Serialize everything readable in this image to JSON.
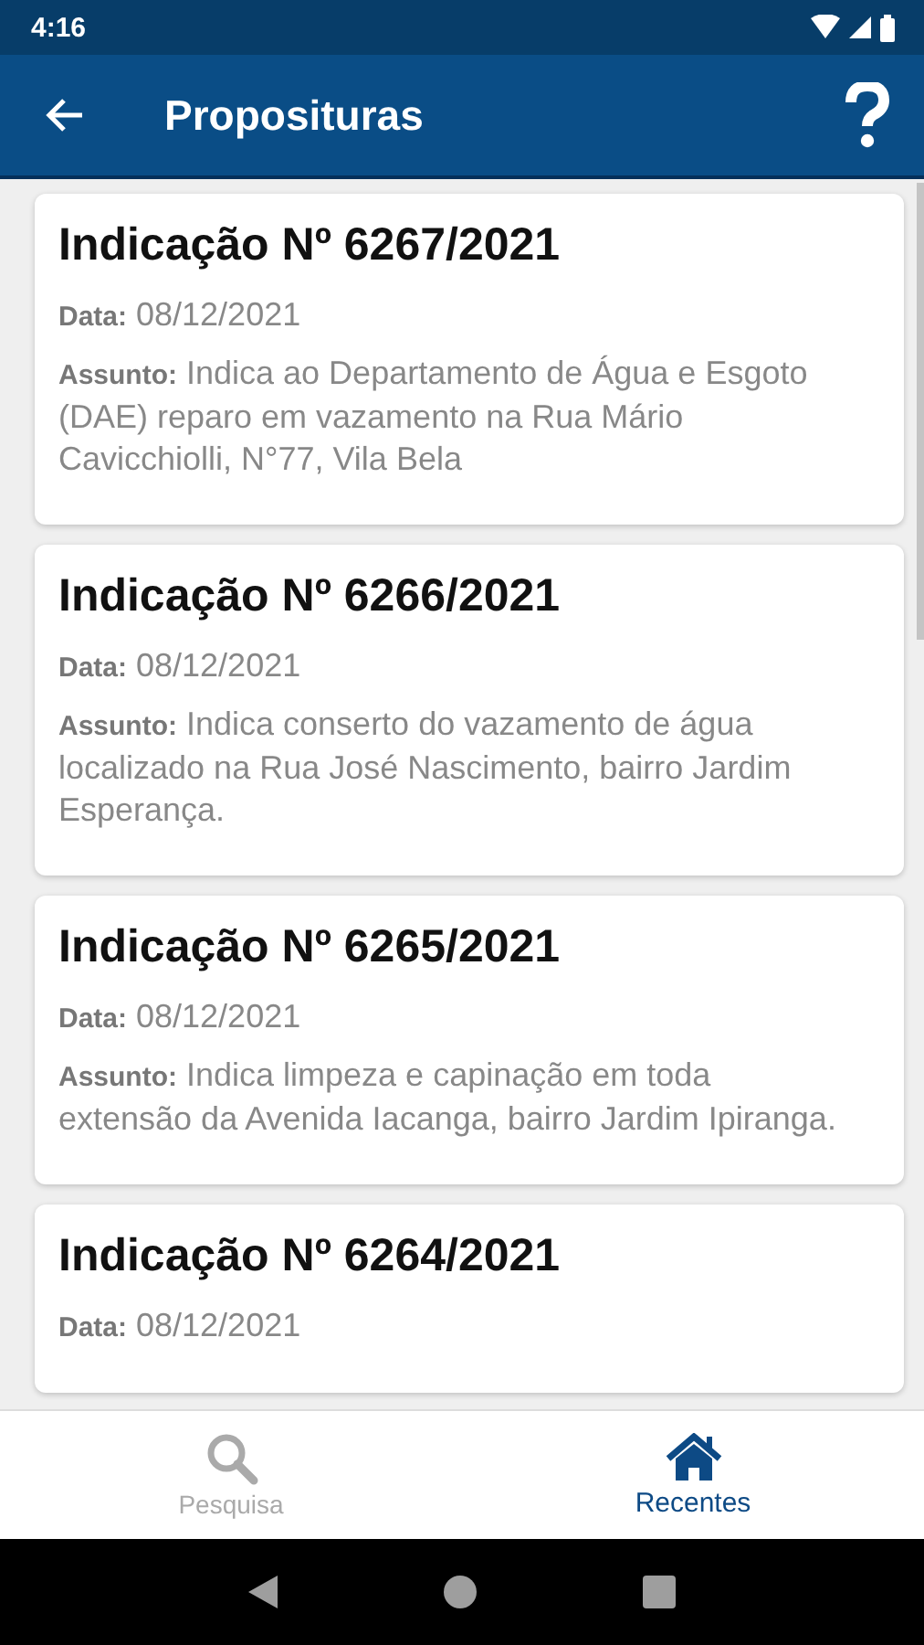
{
  "status_bar": {
    "time": "4:16"
  },
  "app_bar": {
    "title": "Proposituras"
  },
  "items": [
    {
      "title": "Indicação Nº 6267/2021",
      "date_label": "Data:",
      "date": "08/12/2021",
      "subject_label": "Assunto:",
      "subject": "Indica ao Departamento de Água e Esgoto (DAE) reparo em vazamento na Rua Mário Cavicchiolli, N°77, Vila Bela"
    },
    {
      "title": "Indicação Nº 6266/2021",
      "date_label": "Data:",
      "date": "08/12/2021",
      "subject_label": "Assunto:",
      "subject": "Indica conserto do vazamento de água localizado na Rua José Nascimento, bairro Jardim Esperança."
    },
    {
      "title": "Indicação Nº 6265/2021",
      "date_label": "Data:",
      "date": "08/12/2021",
      "subject_label": "Assunto:",
      "subject": "Indica limpeza e capinação em toda extensão da Avenida Iacanga, bairro Jardim Ipiranga."
    },
    {
      "title": "Indicação Nº 6264/2021",
      "date_label": "Data:",
      "date": "08/12/2021"
    }
  ],
  "bottom_nav": [
    {
      "label": "Pesquisa",
      "kind": "search",
      "selected": false
    },
    {
      "label": "Recentes",
      "kind": "home",
      "selected": true
    }
  ]
}
